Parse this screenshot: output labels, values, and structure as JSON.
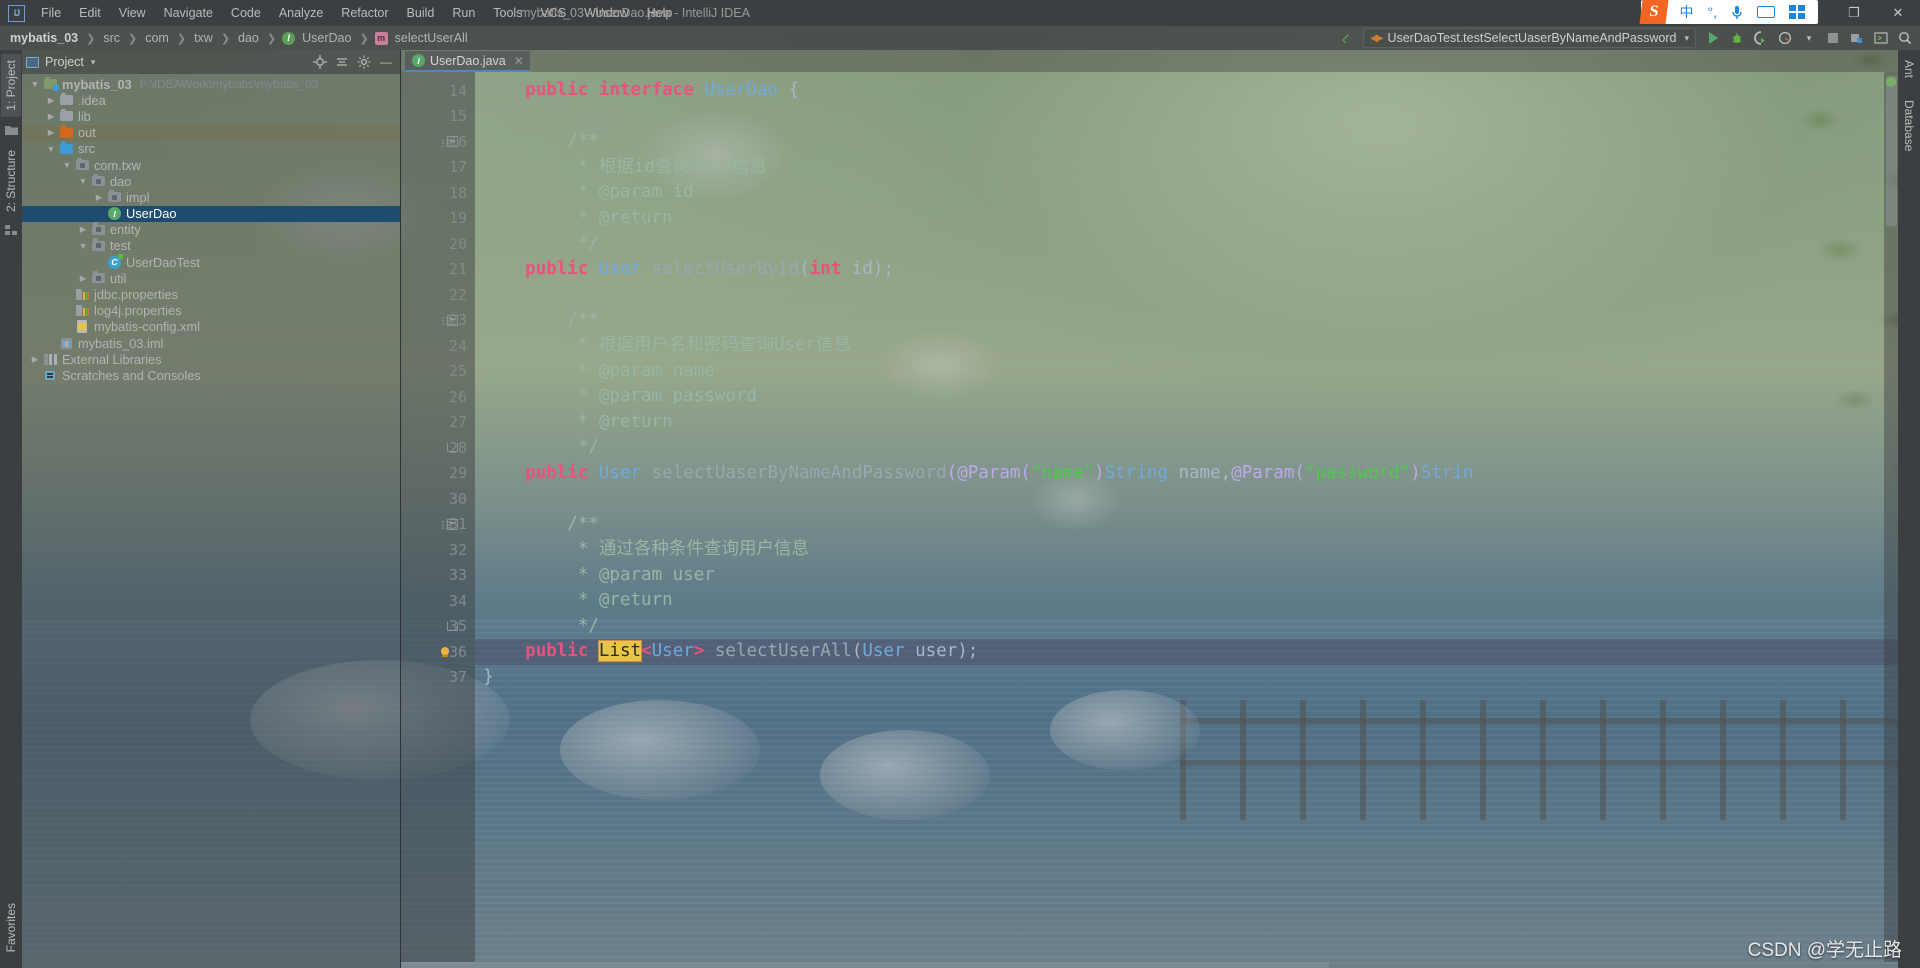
{
  "window": {
    "title": "mybatis_03 - UserDao.java - IntelliJ IDEA",
    "logo": "IJ",
    "minimize": "❐",
    "close": "✕"
  },
  "menu": {
    "items": [
      "File",
      "Edit",
      "View",
      "Navigate",
      "Code",
      "Analyze",
      "Refactor",
      "Build",
      "Run",
      "Tools",
      "VCS",
      "Window",
      "Help"
    ]
  },
  "ime": {
    "brand": "S",
    "mode": "中",
    "punct": "°,",
    "mic": "🎤",
    "keyboard": "keyboard-icon",
    "apps": "apps-icon"
  },
  "breadcrumb": {
    "items": [
      {
        "label": "mybatis_03",
        "icon": "none",
        "bold": true
      },
      {
        "label": "src",
        "icon": "none",
        "bold": false
      },
      {
        "label": "com",
        "icon": "none",
        "bold": false
      },
      {
        "label": "txw",
        "icon": "none",
        "bold": false
      },
      {
        "label": "dao",
        "icon": "none",
        "bold": false
      },
      {
        "label": "UserDao",
        "icon": "interface",
        "bold": false
      },
      {
        "label": "selectUserAll",
        "icon": "method",
        "bold": false
      }
    ]
  },
  "run": {
    "config_name": "UserDaoTest.testSelectUaserByNameAndPassword",
    "caret": "▾",
    "buttons": [
      "run-icon",
      "debug-icon",
      "run-coverage-icon",
      "profiler-icon",
      "stop-icon",
      "build-icon",
      "terminal-icon",
      "search-icon"
    ]
  },
  "toolwindows": {
    "left": [
      "1: Project",
      "2: Structure"
    ],
    "left_bottom": [
      "Favorites"
    ],
    "right": [
      "Ant",
      "Database"
    ]
  },
  "project_panel": {
    "title": "Project",
    "caret": "▾",
    "actions": [
      "locate-icon",
      "collapse-all-icon",
      "settings-gear-icon",
      "hide-icon"
    ],
    "tree": [
      {
        "depth": 0,
        "twisty": "▼",
        "icon": "module",
        "label": "mybatis_03",
        "bold": true,
        "hint": "F:\\IDEAWork\\mybatis\\mybatis_03",
        "state": "normal"
      },
      {
        "depth": 1,
        "twisty": "▶",
        "icon": "folder-gray",
        "label": ".idea",
        "bold": false,
        "hint": "",
        "state": "normal"
      },
      {
        "depth": 1,
        "twisty": "▶",
        "icon": "folder-gray",
        "label": "lib",
        "bold": false,
        "hint": "",
        "state": "normal"
      },
      {
        "depth": 1,
        "twisty": "▶",
        "icon": "folder-orange",
        "label": "out",
        "bold": false,
        "hint": "",
        "state": "hover"
      },
      {
        "depth": 1,
        "twisty": "▼",
        "icon": "folder-blue",
        "label": "src",
        "bold": false,
        "hint": "",
        "state": "normal"
      },
      {
        "depth": 2,
        "twisty": "▼",
        "icon": "package",
        "label": "com.txw",
        "bold": false,
        "hint": "",
        "state": "normal"
      },
      {
        "depth": 3,
        "twisty": "▼",
        "icon": "package",
        "label": "dao",
        "bold": false,
        "hint": "",
        "state": "normal"
      },
      {
        "depth": 4,
        "twisty": "▶",
        "icon": "package",
        "label": "impl",
        "bold": false,
        "hint": "",
        "state": "normal"
      },
      {
        "depth": 4,
        "twisty": "",
        "icon": "interface",
        "label": "UserDao",
        "bold": false,
        "hint": "",
        "state": "selected"
      },
      {
        "depth": 3,
        "twisty": "▶",
        "icon": "package",
        "label": "entity",
        "bold": false,
        "hint": "",
        "state": "normal"
      },
      {
        "depth": 3,
        "twisty": "▼",
        "icon": "package",
        "label": "test",
        "bold": false,
        "hint": "",
        "state": "normal"
      },
      {
        "depth": 4,
        "twisty": "",
        "icon": "class-test",
        "label": "UserDaoTest",
        "bold": false,
        "hint": "",
        "state": "normal"
      },
      {
        "depth": 3,
        "twisty": "▶",
        "icon": "package",
        "label": "util",
        "bold": false,
        "hint": "",
        "state": "normal"
      },
      {
        "depth": 2,
        "twisty": "",
        "icon": "properties",
        "label": "jdbc.properties",
        "bold": false,
        "hint": "",
        "state": "normal"
      },
      {
        "depth": 2,
        "twisty": "",
        "icon": "properties",
        "label": "log4j.properties",
        "bold": false,
        "hint": "",
        "state": "normal"
      },
      {
        "depth": 2,
        "twisty": "",
        "icon": "xml",
        "label": "mybatis-config.xml",
        "bold": false,
        "hint": "",
        "state": "normal"
      },
      {
        "depth": 1,
        "twisty": "",
        "icon": "iml",
        "label": "mybatis_03.iml",
        "bold": false,
        "hint": "",
        "state": "normal"
      },
      {
        "depth": 0,
        "twisty": "▶",
        "icon": "library",
        "label": "External Libraries",
        "bold": false,
        "hint": "",
        "state": "normal"
      },
      {
        "depth": 0,
        "twisty": "",
        "icon": "scratch",
        "label": "Scratches and Consoles",
        "bold": false,
        "hint": "",
        "state": "normal"
      }
    ]
  },
  "editor": {
    "tab": {
      "label": "UserDao.java",
      "icon": "interface",
      "close": "✕"
    },
    "first_line": 14,
    "current_line": 36,
    "lines": [
      {
        "n": 14,
        "gutter": "",
        "fold": false,
        "tokens": [
          {
            "t": "    ",
            "c": "punct"
          },
          {
            "t": "public",
            "c": "kw-pink"
          },
          {
            "t": " ",
            "c": "punct"
          },
          {
            "t": "interface",
            "c": "kw-pink"
          },
          {
            "t": " ",
            "c": "punct"
          },
          {
            "t": "UserDao",
            "c": "typ2"
          },
          {
            "t": " {",
            "c": "punct"
          }
        ]
      },
      {
        "n": 15,
        "gutter": "",
        "fold": false,
        "tokens": []
      },
      {
        "n": 16,
        "gutter": "fold",
        "fold": true,
        "tokens": [
          {
            "t": "        /**",
            "c": "cm2"
          }
        ]
      },
      {
        "n": 17,
        "gutter": "",
        "fold": false,
        "tokens": [
          {
            "t": "         * 根据id查询User信息",
            "c": "cm2"
          }
        ]
      },
      {
        "n": 18,
        "gutter": "",
        "fold": false,
        "tokens": [
          {
            "t": "         * @param id",
            "c": "cm2"
          }
        ]
      },
      {
        "n": 19,
        "gutter": "",
        "fold": false,
        "tokens": [
          {
            "t": "         * @return",
            "c": "cm2"
          }
        ]
      },
      {
        "n": 20,
        "gutter": "",
        "fold": false,
        "tokens": [
          {
            "t": "         */",
            "c": "cm2"
          }
        ]
      },
      {
        "n": 21,
        "gutter": "",
        "fold": false,
        "tokens": [
          {
            "t": "    ",
            "c": "punct"
          },
          {
            "t": "public",
            "c": "kw-pink"
          },
          {
            "t": " ",
            "c": "punct"
          },
          {
            "t": "User",
            "c": "typ2"
          },
          {
            "t": " ",
            "c": "punct"
          },
          {
            "t": "selectUserById",
            "c": "mth"
          },
          {
            "t": "(",
            "c": "punct"
          },
          {
            "t": "int",
            "c": "kw-pink"
          },
          {
            "t": " id);",
            "c": "punct"
          }
        ]
      },
      {
        "n": 22,
        "gutter": "",
        "fold": false,
        "tokens": []
      },
      {
        "n": 23,
        "gutter": "fold",
        "fold": true,
        "tokens": [
          {
            "t": "        /**",
            "c": "cm2"
          }
        ]
      },
      {
        "n": 24,
        "gutter": "",
        "fold": false,
        "tokens": [
          {
            "t": "         * 根据用户名和密码查询User信息",
            "c": "cm2"
          }
        ]
      },
      {
        "n": 25,
        "gutter": "",
        "fold": false,
        "tokens": [
          {
            "t": "         * @param name",
            "c": "cm2"
          }
        ]
      },
      {
        "n": 26,
        "gutter": "",
        "fold": false,
        "tokens": [
          {
            "t": "         * @param password",
            "c": "cm2"
          }
        ]
      },
      {
        "n": 27,
        "gutter": "",
        "fold": false,
        "tokens": [
          {
            "t": "         * @return",
            "c": "cm2"
          }
        ]
      },
      {
        "n": 28,
        "gutter": "foldend",
        "fold": true,
        "tokens": [
          {
            "t": "         */",
            "c": "cm2"
          }
        ]
      },
      {
        "n": 29,
        "gutter": "",
        "fold": false,
        "tokens": [
          {
            "t": "    ",
            "c": "punct"
          },
          {
            "t": "public",
            "c": "kw-pink"
          },
          {
            "t": " ",
            "c": "punct"
          },
          {
            "t": "User",
            "c": "typ2"
          },
          {
            "t": " ",
            "c": "punct"
          },
          {
            "t": "selectUaserByNameAndPassword",
            "c": "mth"
          },
          {
            "t": "(",
            "c": "ann"
          },
          {
            "t": "@Param",
            "c": "ann"
          },
          {
            "t": "(",
            "c": "ann"
          },
          {
            "t": "\"name\"",
            "c": "strg"
          },
          {
            "t": ")",
            "c": "ann"
          },
          {
            "t": "String",
            "c": "typ2"
          },
          {
            "t": " name,",
            "c": "punct"
          },
          {
            "t": "@Param",
            "c": "ann"
          },
          {
            "t": "(",
            "c": "ann"
          },
          {
            "t": "\"password\"",
            "c": "strg"
          },
          {
            "t": ")",
            "c": "ann"
          },
          {
            "t": "Strin",
            "c": "typ2"
          }
        ]
      },
      {
        "n": 30,
        "gutter": "",
        "fold": false,
        "tokens": []
      },
      {
        "n": 31,
        "gutter": "fold",
        "fold": true,
        "tokens": [
          {
            "t": "        /**",
            "c": "cm2"
          }
        ]
      },
      {
        "n": 32,
        "gutter": "",
        "fold": false,
        "tokens": [
          {
            "t": "         * 通过各种条件查询用户信息",
            "c": "cm2"
          }
        ]
      },
      {
        "n": 33,
        "gutter": "",
        "fold": false,
        "tokens": [
          {
            "t": "         * @param user",
            "c": "cm2"
          }
        ]
      },
      {
        "n": 34,
        "gutter": "",
        "fold": false,
        "tokens": [
          {
            "t": "         * @return",
            "c": "cm2"
          }
        ]
      },
      {
        "n": 35,
        "gutter": "foldend",
        "fold": true,
        "tokens": [
          {
            "t": "         */",
            "c": "cm2"
          }
        ]
      },
      {
        "n": 36,
        "gutter": "bulb",
        "fold": false,
        "current": true,
        "tokens": [
          {
            "t": "    ",
            "c": "punct"
          },
          {
            "t": "public",
            "c": "kw-pink"
          },
          {
            "t": " ",
            "c": "punct"
          },
          {
            "t": "List",
            "c": "sel-hl"
          },
          {
            "t": "<",
            "c": "kw-pink"
          },
          {
            "t": "User",
            "c": "typ2"
          },
          {
            "t": ">",
            "c": "kw-pink"
          },
          {
            "t": " ",
            "c": "punct"
          },
          {
            "t": "selectUserAll",
            "c": "mth"
          },
          {
            "t": "(",
            "c": "punct"
          },
          {
            "t": "User",
            "c": "typ2"
          },
          {
            "t": " user);",
            "c": "punct"
          }
        ]
      },
      {
        "n": 37,
        "gutter": "",
        "fold": false,
        "tokens": [
          {
            "t": "}",
            "c": "punct"
          }
        ]
      }
    ]
  },
  "watermark": "CSDN @学无止路"
}
